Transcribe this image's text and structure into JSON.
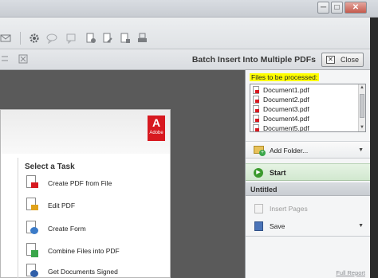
{
  "window": {
    "min_glyph": "─",
    "max_glyph": "□",
    "close_glyph": "✕"
  },
  "toolbar": {
    "icons": [
      "email-icon",
      "gear-icon",
      "comment-icon",
      "share-icon",
      "lock-icon",
      "sign-icon",
      "protect-icon",
      "stamp-icon"
    ]
  },
  "panel": {
    "title": "Batch Insert Into Multiple PDFs",
    "close_label": "Close",
    "files_label": "Files to be processed:",
    "files": [
      "Document1.pdf",
      "Document2.pdf",
      "Document3.pdf",
      "Document4.pdf",
      "Document5.pdf"
    ],
    "add_folder_label": "Add Folder...",
    "start_label": "Start",
    "section_title": "Untitled",
    "insert_pages_label": "Insert Pages",
    "save_label": "Save",
    "full_report_label": "Full Report"
  },
  "card": {
    "logo_text": "A",
    "logo_wordmark": "Adobe",
    "heading": "Select a Task",
    "tasks": [
      "Create PDF from File",
      "Edit PDF",
      "Create Form",
      "Combine Files into PDF",
      "Get Documents Signed"
    ]
  },
  "colors": {
    "highlight": "#ffff00",
    "adobe_red": "#d71920",
    "start_green": "#3c9a2e"
  }
}
